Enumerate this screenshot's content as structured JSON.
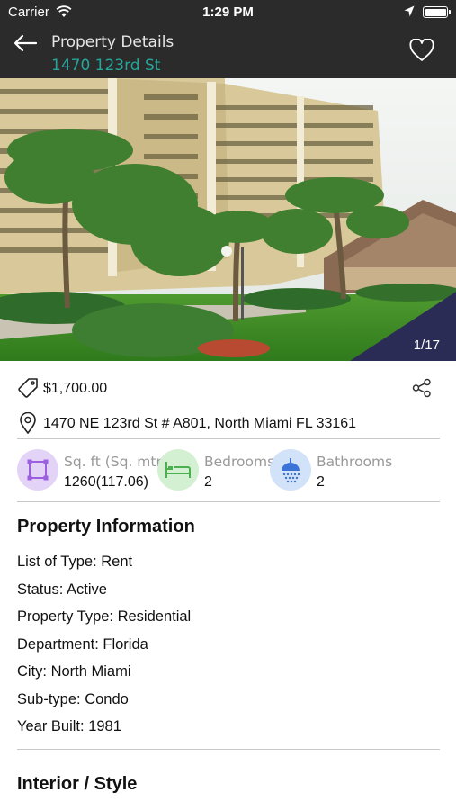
{
  "status_bar": {
    "carrier": "Carrier",
    "time": "1:29 PM"
  },
  "nav": {
    "title": "Property Details",
    "subtitle": "1470 123rd St",
    "accent": "#26a69a"
  },
  "photo": {
    "counter": "1/17"
  },
  "listing": {
    "price": "$1,700.00",
    "address": "1470 NE 123rd St # A801, North Miami FL 33161"
  },
  "stats": [
    {
      "label": "Sq. ft (Sq. mtr)",
      "value": "1260(117.06)",
      "icon": "square-area-icon",
      "color": "#9c5fe0"
    },
    {
      "label": "Bedrooms",
      "value": "2",
      "icon": "bed-icon",
      "color": "#4caf50"
    },
    {
      "label": "Bathrooms",
      "value": "2",
      "icon": "shower-icon",
      "color": "#3b73d6"
    }
  ],
  "property_information": {
    "heading": "Property Information",
    "lines": [
      "List of Type:  Rent",
      "Status: Active",
      "Property Type:  Residential",
      "Department: Florida",
      "City: North Miami",
      "Sub-type: Condo",
      "Year Built: 1981"
    ]
  },
  "interior": {
    "heading": "Interior / Style"
  }
}
